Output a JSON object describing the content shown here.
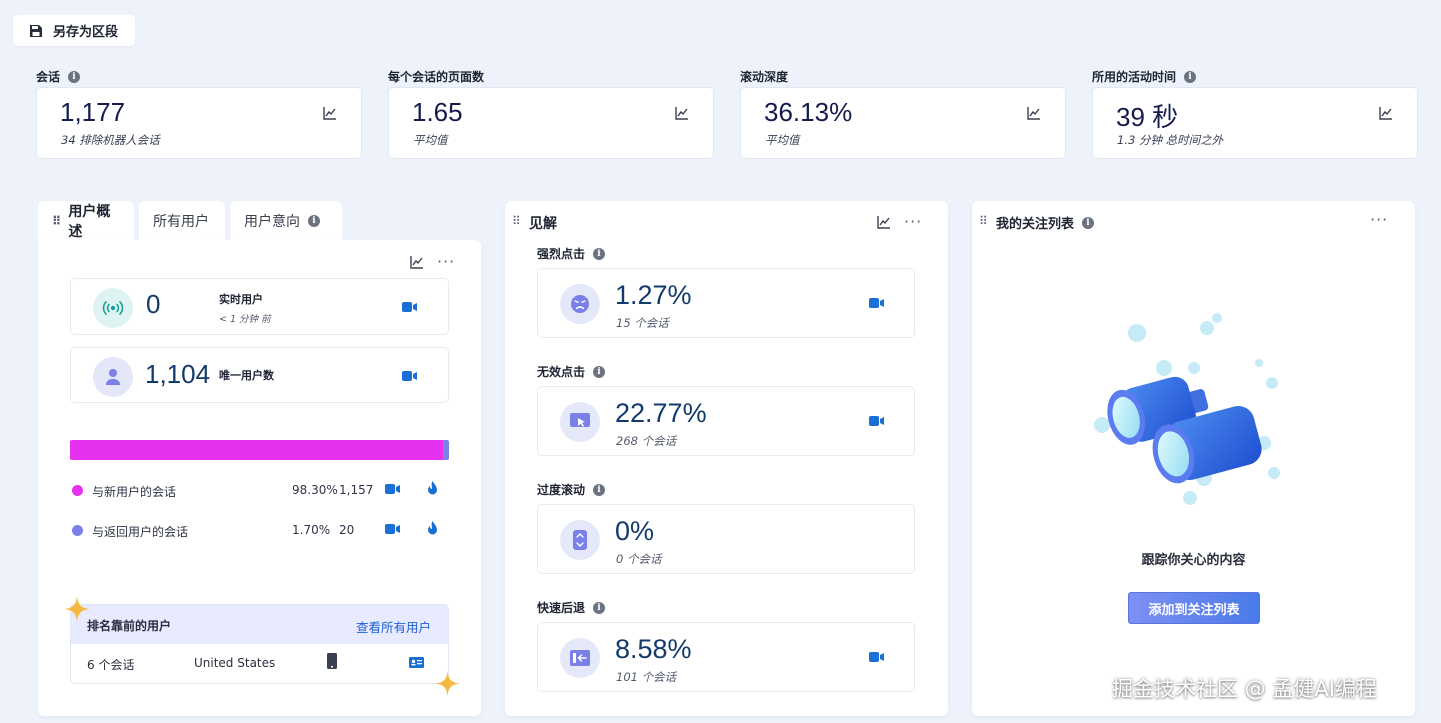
{
  "toolbar": {
    "save_label": "另存为区段"
  },
  "kpis": [
    {
      "label": "会话",
      "value": "1,177",
      "sub": "34 排除机器人会话",
      "info": true
    },
    {
      "label": "每个会话的页面数",
      "value": "1.65",
      "sub": "平均值",
      "info": false
    },
    {
      "label": "滚动深度",
      "value": "36.13%",
      "sub": "平均值",
      "info": false
    },
    {
      "label": "所用的活动时间",
      "value": "39 秒",
      "sub": "1.3 分钟 总时间之外",
      "info": true
    }
  ],
  "users_panel": {
    "tabs": [
      "用户概述",
      "所有用户",
      "用户意向"
    ],
    "live": {
      "value": "0",
      "label": "实时用户",
      "sub": "< 1 分钟 前"
    },
    "unique": {
      "value": "1,104",
      "label": "唯一用户数"
    },
    "split": {
      "new_fraction": 0.983,
      "new_color": "#e632ef",
      "returning_color": "#7b7fe8"
    },
    "legend": [
      {
        "label": "与新用户的会话",
        "pct": "98.30%",
        "count": "1,157"
      },
      {
        "label": "与返回用户的会话",
        "pct": "1.70%",
        "count": "20"
      }
    ],
    "top_users": {
      "title": "排名靠前的用户",
      "link": "查看所有用户",
      "rows": [
        {
          "sessions": "6 个会话",
          "country": "United States"
        }
      ]
    }
  },
  "insights_panel": {
    "title": "见解",
    "items": [
      {
        "label": "强烈点击",
        "value": "1.27%",
        "sub": "15 个会话",
        "icon": "angry-face-icon"
      },
      {
        "label": "无效点击",
        "value": "22.77%",
        "sub": "268 个会话",
        "icon": "dead-click-icon"
      },
      {
        "label": "过度滚动",
        "value": "0%",
        "sub": "0 个会话",
        "icon": "scroll-icon"
      },
      {
        "label": "快速后退",
        "value": "8.58%",
        "sub": "101 个会话",
        "icon": "quick-back-icon"
      }
    ]
  },
  "watchlist_panel": {
    "title": "我的关注列表",
    "empty_text": "跟踪你关心的内容",
    "cta": "添加到关注列表"
  },
  "watermark": "掘金技术社区 @ 孟健AI编程"
}
